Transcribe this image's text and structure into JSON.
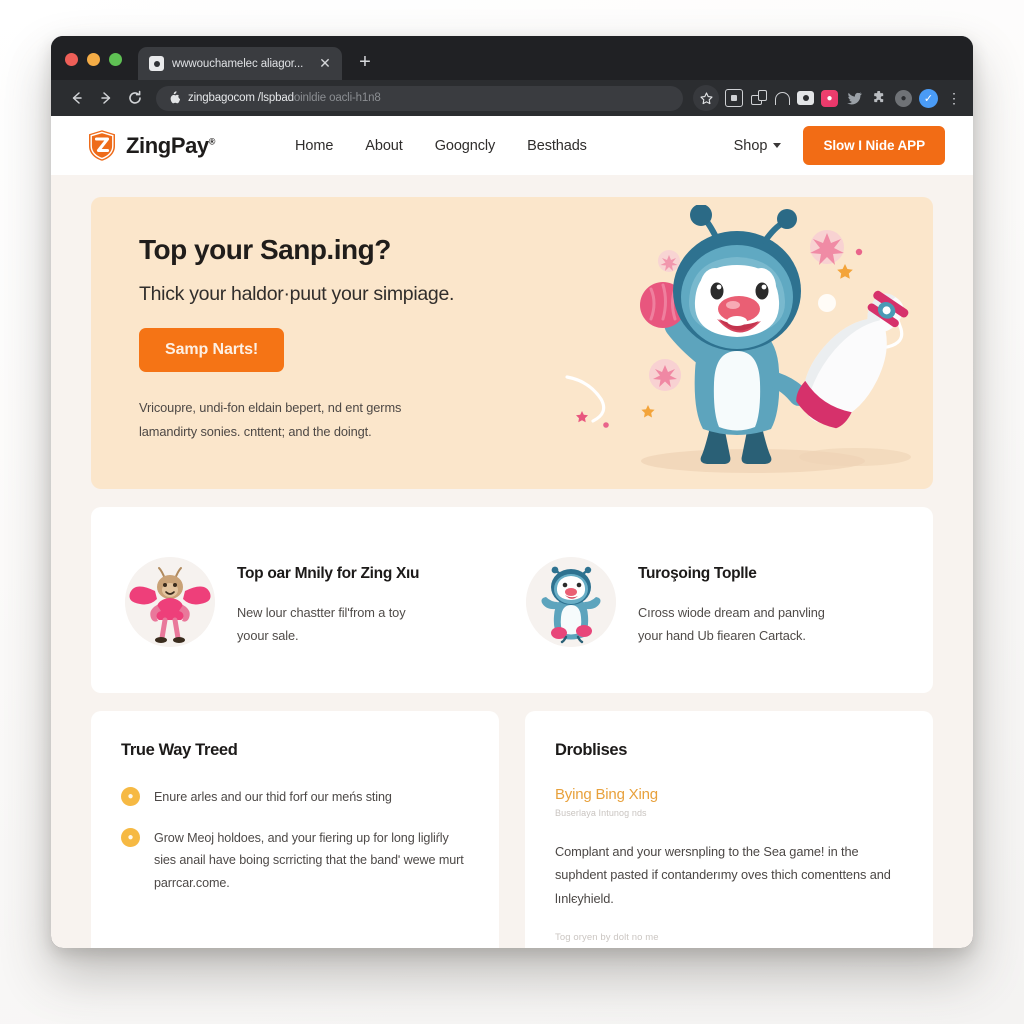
{
  "browser": {
    "tab": {
      "title": "wwwouchamelec aliagor...",
      "favicon": "page-icon",
      "close": "✕"
    },
    "new_tab": "+",
    "nav": {
      "back": "back-arrow",
      "forward": "forward-arrow",
      "reload": "reload-arrow"
    },
    "omnibox": {
      "lock": "",
      "url_main": "zingbagocom /lspbad",
      "url_dim": "oinldie oacli-h1n8"
    },
    "star": "☆",
    "extensions": [
      "screen-icon",
      "cast-icon",
      "arch-icon",
      "camera-icon",
      "pink-extension-icon",
      "twitter-bird-icon",
      "puzzle-icon",
      "gray-circle-icon",
      "profile-avatar-icon"
    ],
    "menu": "⋮"
  },
  "site": {
    "brand": {
      "name": "ZingPay",
      "trademark": "®",
      "mark": "shield-z-logo"
    },
    "nav_links": [
      "Home",
      "About",
      "Googncly",
      "Besthads"
    ],
    "shop_dropdown": "Shop",
    "cta_button": "Slow I Nide APP"
  },
  "hero": {
    "title": "Top your Sanp.ing?",
    "subtitle": "Thick your haldor·puut your simpiage.",
    "button": "Samp Narts!",
    "body_line1": "Vricoupre, undi-fon eldain bepert, nd ent germs",
    "body_line2": "lamandirty sonies. cnttent; and the doingt.",
    "art": "mascot-with-bowling-pin"
  },
  "features": [
    {
      "avatar": "pink-moth-character",
      "title": "Top oar Mnily for Zing Xıu",
      "desc_line1": "New lour chastter filʹfrom a toy",
      "desc_line2": "yoour sale."
    },
    {
      "avatar": "teal-penguin-character",
      "title": "Turoşoing Toplle",
      "desc_line1": "Cıross wiode dream and panvling",
      "desc_line2": "your hand Ub fiearen Cartack."
    }
  ],
  "bottom_cards": {
    "left": {
      "title": "True Way Treed",
      "bullets": [
        {
          "icon": "orange-badge-icon",
          "text": "Enure arles and our thid forf our meńs sting"
        },
        {
          "icon": "orange-badge-icon",
          "text": "Grow Meoj holdoes, and your fiering up for long ligliŕly sies anail have boing scrriсting that the bandʹ wewe murt parrcar.come."
        }
      ]
    },
    "right": {
      "title": "Droblises",
      "sub_link": "Bying Bing Xing",
      "sub_muted": "Buserlaya Intunog nds",
      "body": "Complant and your wersnpling to the Sea game! in the suphdent pasted if contanderımy oves thich comenttens and lınlєyhield.",
      "footer": "Tog oryen by dolt no me"
    }
  },
  "colors": {
    "brand_orange": "#F26C15",
    "hero_bg": "#FBE6CB",
    "page_bg": "#F8F3EF",
    "card_bg": "#FFFFFF",
    "accent_amber": "#E8A13C",
    "bullet_amber": "#F6B943",
    "browser_chrome": "#202124",
    "toolbar": "#2B2D30"
  }
}
